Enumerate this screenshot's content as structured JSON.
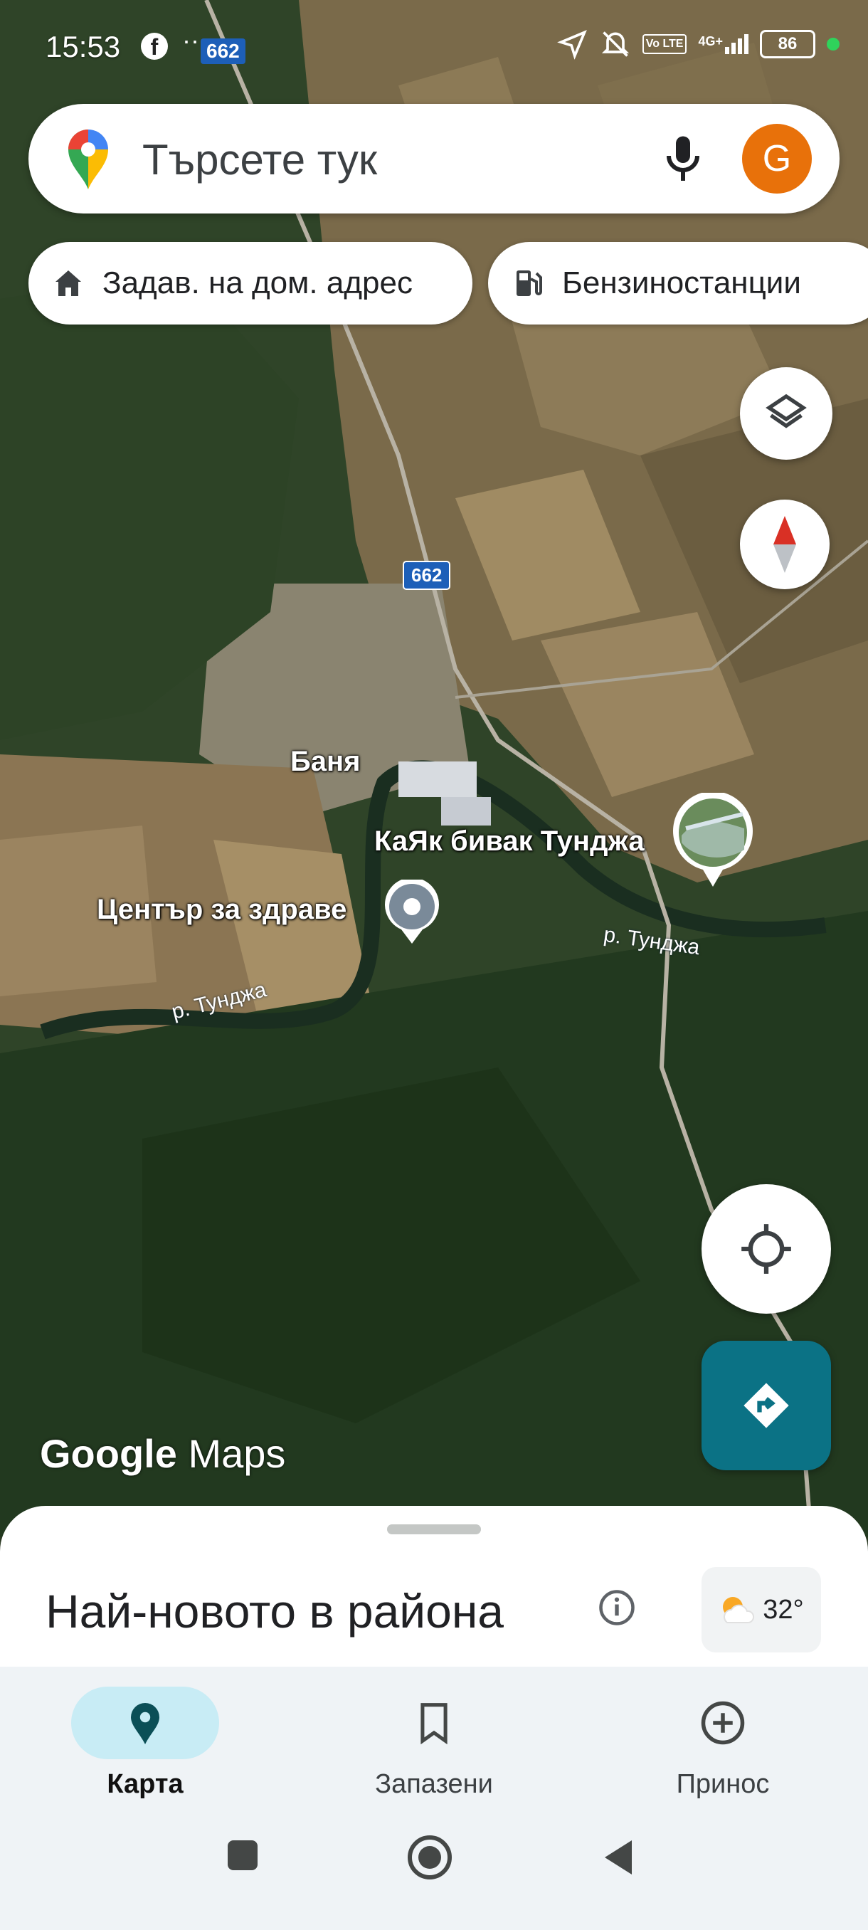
{
  "status_bar": {
    "time": "15:53",
    "road_badge": "662",
    "battery": "86",
    "network": "4G+",
    "volte": "Vo LTE"
  },
  "search": {
    "placeholder": "Търсете тук",
    "avatar_letter": "G"
  },
  "chips": [
    {
      "label": "Задав. на дом. адрес",
      "icon": "home-icon"
    },
    {
      "label": "Бензиностанции",
      "icon": "gas-station-icon"
    }
  ],
  "map": {
    "labels": {
      "village": "Баня",
      "kayak": "КаЯк бивак Тунджа",
      "health": "Център за здраве",
      "river_1": "р. Тунджа",
      "river_2": "р. Тунджа",
      "road_shield": "662"
    },
    "logo": {
      "brand": "Google",
      "product": "Maps"
    }
  },
  "sheet": {
    "title": "Най-новото в района",
    "weather_temp": "32°"
  },
  "bottom_nav": [
    {
      "label": "Карта",
      "icon": "map-pin-icon",
      "active": true
    },
    {
      "label": "Запазени",
      "icon": "bookmark-icon",
      "active": false
    },
    {
      "label": "Принос",
      "icon": "add-circle-icon",
      "active": false
    }
  ],
  "colors": {
    "accent": "#0b7285",
    "avatar": "#e8710a",
    "active_pill": "#c8ecf5"
  }
}
